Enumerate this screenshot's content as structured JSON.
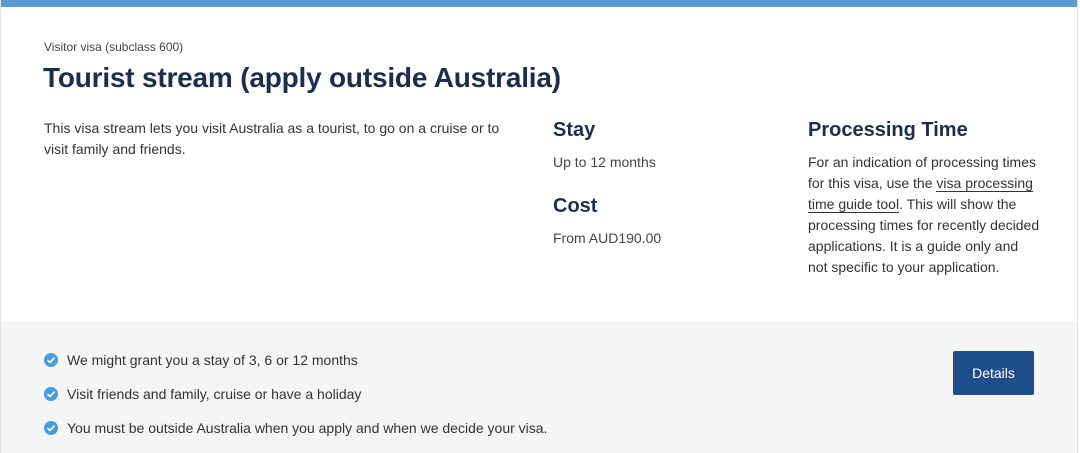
{
  "header": {
    "eyebrow": "Visitor visa (subclass 600)",
    "title": "Tourist stream (apply outside Australia)",
    "description": "This visa stream lets you visit Australia as a tourist, to go on a cruise or to visit family and friends."
  },
  "stay": {
    "heading": "Stay",
    "value": "Up to 12 months"
  },
  "cost": {
    "heading": "Cost",
    "value": "From AUD190.00"
  },
  "processing": {
    "heading": "Processing Time",
    "text_before": "For an indication of processing times for this visa, use the ",
    "link_label": "visa processing time guide tool",
    "text_after": ". This will show the processing times for recently decided applications. It is a guide only and not specific to your application."
  },
  "footer": {
    "bullets": [
      "We might grant you a stay of 3, 6 or 12 months",
      "Visit friends and family, cruise or have a holiday",
      "You must be outside Australia when you apply and when we decide your visa."
    ],
    "details_label": "Details"
  },
  "colors": {
    "top_bar": "#5b9bd5",
    "title": "#1b2e4d",
    "check": "#4a9be0",
    "button": "#1d4e8a",
    "footer_bg": "#f5f5f5"
  }
}
